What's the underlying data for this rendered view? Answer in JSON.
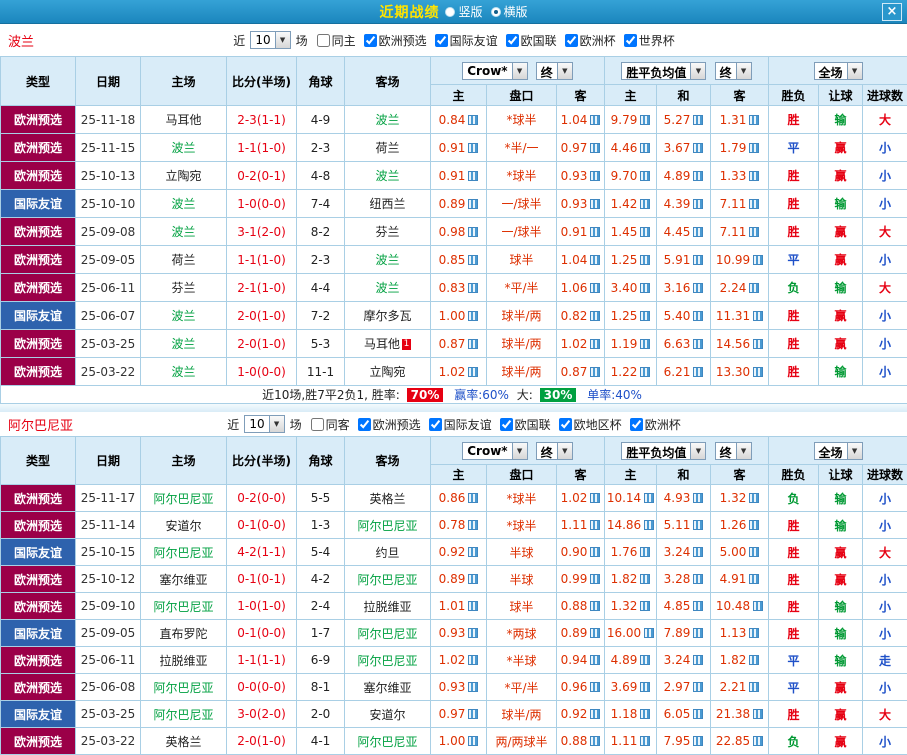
{
  "topbar": {
    "title": "近期战绩",
    "view_options": [
      {
        "label": "竖版",
        "selected": false
      },
      {
        "label": "横版",
        "selected": true
      }
    ],
    "close_label": "×"
  },
  "colors": {
    "titlebar_blue": "#1b86bd",
    "title_yellow": "#ffe400",
    "type_qualifier_bg": "#9b0048",
    "type_friendly_bg": "#2e62ad",
    "team_highlight_green": "#00a040",
    "score_red": "#e60012",
    "outcome_blue": "#1e50c8",
    "outcome_green": "#009933",
    "header_bg": "#d9ecf8"
  },
  "sections": [
    {
      "team": "波兰",
      "filter": {
        "near_label": "近",
        "count": "10",
        "games_label": "场",
        "checkboxes": [
          {
            "label": "同主",
            "checked": false
          },
          {
            "label": "欧洲预选",
            "checked": true
          },
          {
            "label": "国际友谊",
            "checked": true
          },
          {
            "label": "欧国联",
            "checked": true
          },
          {
            "label": "欧洲杯",
            "checked": true
          },
          {
            "label": "世界杯",
            "checked": true
          }
        ]
      },
      "header": {
        "cols": [
          "类型",
          "日期",
          "主场",
          "比分(半场)",
          "角球",
          "客场"
        ],
        "company": "Crow*",
        "final1": "终",
        "odds_avg": "胜平负均值",
        "final2": "终",
        "scope": "全场",
        "sub": [
          "主",
          "盘口",
          "客",
          "主",
          "和",
          "客",
          "胜负",
          "让球",
          "进球数"
        ]
      },
      "rows": [
        {
          "type": "欧洲预选",
          "tclass": "qual",
          "date": "25-11-18",
          "home": "马耳他",
          "home_hl": false,
          "home_card": "",
          "score": "2-3(1-1)",
          "corner": "4-9",
          "away": "波兰",
          "away_hl": true,
          "away_card": "",
          "ho": "0.84",
          "line": "*球半",
          "ao": "1.04",
          "avg_h": "9.79",
          "avg_d": "5.27",
          "avg_a": "1.31",
          "res": "胜",
          "rng": "输",
          "big": "大"
        },
        {
          "type": "欧洲预选",
          "tclass": "qual",
          "date": "25-11-15",
          "home": "波兰",
          "home_hl": true,
          "home_card": "",
          "score": "1-1(1-0)",
          "corner": "2-3",
          "away": "荷兰",
          "away_hl": false,
          "away_card": "",
          "ho": "0.91",
          "line": "*半/一",
          "ao": "0.97",
          "avg_h": "4.46",
          "avg_d": "3.67",
          "avg_a": "1.79",
          "res": "平",
          "rng": "赢",
          "big": "小"
        },
        {
          "type": "欧洲预选",
          "tclass": "qual",
          "date": "25-10-13",
          "home": "立陶宛",
          "home_hl": false,
          "home_card": "",
          "score": "0-2(0-1)",
          "corner": "4-8",
          "away": "波兰",
          "away_hl": true,
          "away_card": "",
          "ho": "0.91",
          "line": "*球半",
          "ao": "0.93",
          "avg_h": "9.70",
          "avg_d": "4.89",
          "avg_a": "1.33",
          "res": "胜",
          "rng": "赢",
          "big": "小"
        },
        {
          "type": "国际友谊",
          "tclass": "friendly",
          "date": "25-10-10",
          "home": "波兰",
          "home_hl": true,
          "home_card": "",
          "score": "1-0(0-0)",
          "corner": "7-4",
          "away": "纽西兰",
          "away_hl": false,
          "away_card": "",
          "ho": "0.89",
          "line": "一/球半",
          "ao": "0.93",
          "avg_h": "1.42",
          "avg_d": "4.39",
          "avg_a": "7.11",
          "res": "胜",
          "rng": "输",
          "big": "小"
        },
        {
          "type": "欧洲预选",
          "tclass": "qual",
          "date": "25-09-08",
          "home": "波兰",
          "home_hl": true,
          "home_card": "",
          "score": "3-1(2-0)",
          "corner": "8-2",
          "away": "芬兰",
          "away_hl": false,
          "away_card": "",
          "ho": "0.98",
          "line": "一/球半",
          "ao": "0.91",
          "avg_h": "1.45",
          "avg_d": "4.45",
          "avg_a": "7.11",
          "res": "胜",
          "rng": "赢",
          "big": "大"
        },
        {
          "type": "欧洲预选",
          "tclass": "qual",
          "date": "25-09-05",
          "home": "荷兰",
          "home_hl": false,
          "home_card": "",
          "score": "1-1(1-0)",
          "corner": "2-3",
          "away": "波兰",
          "away_hl": true,
          "away_card": "",
          "ho": "0.85",
          "line": "球半",
          "ao": "1.04",
          "avg_h": "1.25",
          "avg_d": "5.91",
          "avg_a": "10.99",
          "res": "平",
          "rng": "赢",
          "big": "小"
        },
        {
          "type": "欧洲预选",
          "tclass": "qual",
          "date": "25-06-11",
          "home": "芬兰",
          "home_hl": false,
          "home_card": "",
          "score": "2-1(1-0)",
          "corner": "4-4",
          "away": "波兰",
          "away_hl": true,
          "away_card": "",
          "ho": "0.83",
          "line": "*平/半",
          "ao": "1.06",
          "avg_h": "3.40",
          "avg_d": "3.16",
          "avg_a": "2.24",
          "res": "负",
          "rng": "输",
          "big": "大"
        },
        {
          "type": "国际友谊",
          "tclass": "friendly",
          "date": "25-06-07",
          "home": "波兰",
          "home_hl": true,
          "home_card": "",
          "score": "2-0(1-0)",
          "corner": "7-2",
          "away": "摩尔多瓦",
          "away_hl": false,
          "away_card": "",
          "ho": "1.00",
          "line": "球半/两",
          "ao": "0.82",
          "avg_h": "1.25",
          "avg_d": "5.40",
          "avg_a": "11.31",
          "res": "胜",
          "rng": "赢",
          "big": "小"
        },
        {
          "type": "欧洲预选",
          "tclass": "qual",
          "date": "25-03-25",
          "home": "波兰",
          "home_hl": true,
          "home_card": "",
          "score": "2-0(1-0)",
          "corner": "5-3",
          "away": "马耳他",
          "away_hl": false,
          "away_card": "1",
          "ho": "0.87",
          "line": "球半/两",
          "ao": "1.02",
          "avg_h": "1.19",
          "avg_d": "6.63",
          "avg_a": "14.56",
          "res": "胜",
          "rng": "赢",
          "big": "小"
        },
        {
          "type": "欧洲预选",
          "tclass": "qual",
          "date": "25-03-22",
          "home": "波兰",
          "home_hl": true,
          "home_card": "",
          "score": "1-0(0-0)",
          "corner": "11-1",
          "away": "立陶宛",
          "away_hl": false,
          "away_card": "",
          "ho": "1.02",
          "line": "球半/两",
          "ao": "0.87",
          "avg_h": "1.22",
          "avg_d": "6.21",
          "avg_a": "13.30",
          "res": "胜",
          "rng": "输",
          "big": "小"
        }
      ],
      "summary": {
        "lead": "近10场,胜7平2负1, 胜率:",
        "win_rate": "70%",
        "win_pct_label": "赢率:60%",
        "big_label": "大:",
        "big_rate": "30%",
        "single_label": "单率:40%"
      }
    },
    {
      "team": "阿尔巴尼亚",
      "filter": {
        "near_label": "近",
        "count": "10",
        "games_label": "场",
        "checkboxes": [
          {
            "label": "同客",
            "checked": false
          },
          {
            "label": "欧洲预选",
            "checked": true
          },
          {
            "label": "国际友谊",
            "checked": true
          },
          {
            "label": "欧国联",
            "checked": true
          },
          {
            "label": "欧地区杯",
            "checked": true
          },
          {
            "label": "欧洲杯",
            "checked": true
          }
        ]
      },
      "header": {
        "cols": [
          "类型",
          "日期",
          "主场",
          "比分(半场)",
          "角球",
          "客场"
        ],
        "company": "Crow*",
        "final1": "终",
        "odds_avg": "胜平负均值",
        "final2": "终",
        "scope": "全场",
        "sub": [
          "主",
          "盘口",
          "客",
          "主",
          "和",
          "客",
          "胜负",
          "让球",
          "进球数"
        ]
      },
      "rows": [
        {
          "type": "欧洲预选",
          "tclass": "qual",
          "date": "25-11-17",
          "home": "阿尔巴尼亚",
          "home_hl": true,
          "home_card": "",
          "score": "0-2(0-0)",
          "corner": "5-5",
          "away": "英格兰",
          "away_hl": false,
          "away_card": "",
          "ho": "0.86",
          "line": "*球半",
          "ao": "1.02",
          "avg_h": "10.14",
          "avg_d": "4.93",
          "avg_a": "1.32",
          "res": "负",
          "rng": "输",
          "big": "小"
        },
        {
          "type": "欧洲预选",
          "tclass": "qual",
          "date": "25-11-14",
          "home": "安道尔",
          "home_hl": false,
          "home_card": "",
          "score": "0-1(0-0)",
          "corner": "1-3",
          "away": "阿尔巴尼亚",
          "away_hl": true,
          "away_card": "",
          "ho": "0.78",
          "line": "*球半",
          "ao": "1.11",
          "avg_h": "14.86",
          "avg_d": "5.11",
          "avg_a": "1.26",
          "res": "胜",
          "rng": "输",
          "big": "小"
        },
        {
          "type": "国际友谊",
          "tclass": "friendly",
          "date": "25-10-15",
          "home": "阿尔巴尼亚",
          "home_hl": true,
          "home_card": "",
          "score": "4-2(1-1)",
          "corner": "5-4",
          "away": "约旦",
          "away_hl": false,
          "away_card": "",
          "ho": "0.92",
          "line": "半球",
          "ao": "0.90",
          "avg_h": "1.76",
          "avg_d": "3.24",
          "avg_a": "5.00",
          "res": "胜",
          "rng": "赢",
          "big": "大"
        },
        {
          "type": "欧洲预选",
          "tclass": "qual",
          "date": "25-10-12",
          "home": "塞尔维亚",
          "home_hl": false,
          "home_card": "",
          "score": "0-1(0-1)",
          "corner": "4-2",
          "away": "阿尔巴尼亚",
          "away_hl": true,
          "away_card": "",
          "ho": "0.89",
          "line": "半球",
          "ao": "0.99",
          "avg_h": "1.82",
          "avg_d": "3.28",
          "avg_a": "4.91",
          "res": "胜",
          "rng": "赢",
          "big": "小"
        },
        {
          "type": "欧洲预选",
          "tclass": "qual",
          "date": "25-09-10",
          "home": "阿尔巴尼亚",
          "home_hl": true,
          "home_card": "",
          "score": "1-0(1-0)",
          "corner": "2-4",
          "away": "拉脱维亚",
          "away_hl": false,
          "away_card": "",
          "ho": "1.01",
          "line": "球半",
          "ao": "0.88",
          "avg_h": "1.32",
          "avg_d": "4.85",
          "avg_a": "10.48",
          "res": "胜",
          "rng": "输",
          "big": "小"
        },
        {
          "type": "国际友谊",
          "tclass": "friendly",
          "date": "25-09-05",
          "home": "直布罗陀",
          "home_hl": false,
          "home_card": "",
          "score": "0-1(0-0)",
          "corner": "1-7",
          "away": "阿尔巴尼亚",
          "away_hl": true,
          "away_card": "",
          "ho": "0.93",
          "line": "*两球",
          "ao": "0.89",
          "avg_h": "16.00",
          "avg_d": "7.89",
          "avg_a": "1.13",
          "res": "胜",
          "rng": "输",
          "big": "小"
        },
        {
          "type": "欧洲预选",
          "tclass": "qual",
          "date": "25-06-11",
          "home": "拉脱维亚",
          "home_hl": false,
          "home_card": "",
          "score": "1-1(1-1)",
          "corner": "6-9",
          "away": "阿尔巴尼亚",
          "away_hl": true,
          "away_card": "",
          "ho": "1.02",
          "line": "*半球",
          "ao": "0.94",
          "avg_h": "4.89",
          "avg_d": "3.24",
          "avg_a": "1.82",
          "res": "平",
          "rng": "输",
          "big": "走"
        },
        {
          "type": "欧洲预选",
          "tclass": "qual",
          "date": "25-06-08",
          "home": "阿尔巴尼亚",
          "home_hl": true,
          "home_card": "",
          "score": "0-0(0-0)",
          "corner": "8-1",
          "away": "塞尔维亚",
          "away_hl": false,
          "away_card": "",
          "ho": "0.93",
          "line": "*平/半",
          "ao": "0.96",
          "avg_h": "3.69",
          "avg_d": "2.97",
          "avg_a": "2.21",
          "res": "平",
          "rng": "赢",
          "big": "小"
        },
        {
          "type": "国际友谊",
          "tclass": "friendly",
          "date": "25-03-25",
          "home": "阿尔巴尼亚",
          "home_hl": true,
          "home_card": "",
          "score": "3-0(2-0)",
          "corner": "2-0",
          "away": "安道尔",
          "away_hl": false,
          "away_card": "",
          "ho": "0.97",
          "line": "球半/两",
          "ao": "0.92",
          "avg_h": "1.18",
          "avg_d": "6.05",
          "avg_a": "21.38",
          "res": "胜",
          "rng": "赢",
          "big": "大"
        },
        {
          "type": "欧洲预选",
          "tclass": "qual",
          "date": "25-03-22",
          "home": "英格兰",
          "home_hl": false,
          "home_card": "",
          "score": "2-0(1-0)",
          "corner": "4-1",
          "away": "阿尔巴尼亚",
          "away_hl": true,
          "away_card": "",
          "ho": "1.00",
          "line": "两/两球半",
          "ao": "0.88",
          "avg_h": "1.11",
          "avg_d": "7.95",
          "avg_a": "22.85",
          "res": "负",
          "rng": "赢",
          "big": "小"
        }
      ]
    }
  ]
}
